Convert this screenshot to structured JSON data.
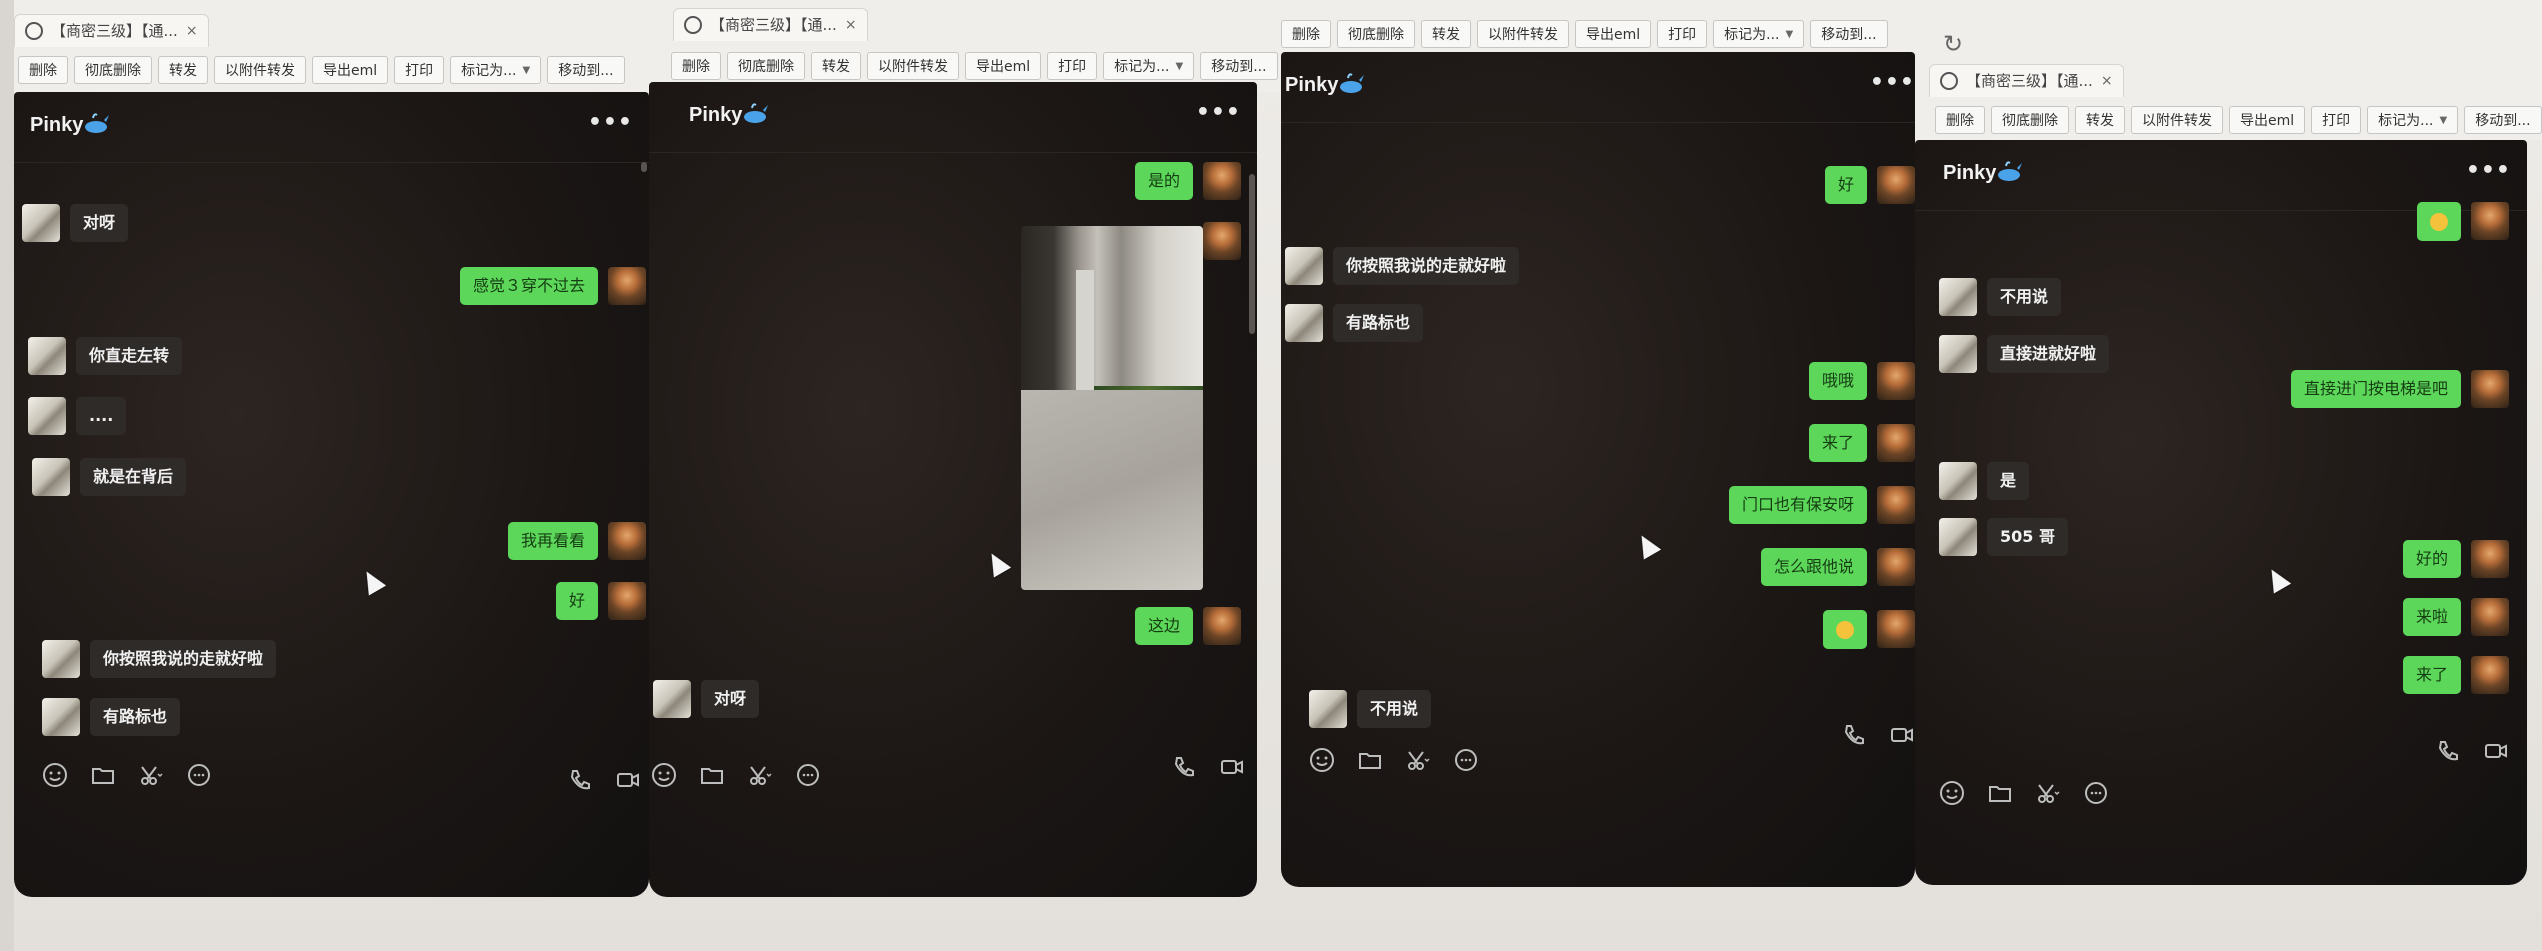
{
  "app": {
    "contact": "Pinky",
    "more": "•••"
  },
  "browser": {
    "tab_title": "【商密三级】【通...",
    "tab_close": "×",
    "toolbar": [
      "删除",
      "彻底删除",
      "转发",
      "以附件转发",
      "导出eml",
      "打印",
      "标记为...",
      "移动到..."
    ]
  },
  "panel1": {
    "messages": [
      {
        "from": "peer",
        "text": "对呀"
      },
      {
        "from": "me",
        "text": "感觉３穿不过去"
      },
      {
        "from": "peer",
        "text": "你直走左转"
      },
      {
        "from": "peer",
        "text": "...."
      },
      {
        "from": "peer",
        "text": "就是在背后"
      },
      {
        "from": "me",
        "text": "我再看看"
      },
      {
        "from": "me",
        "text": "好"
      },
      {
        "from": "peer",
        "text": "你按照我说的走就好啦"
      },
      {
        "from": "peer",
        "text": "有路标也"
      }
    ]
  },
  "panel2": {
    "messages": [
      {
        "from": "me",
        "text": "是的"
      },
      {
        "from": "me",
        "text": "这边"
      },
      {
        "from": "peer",
        "text": "对呀"
      }
    ]
  },
  "panel3": {
    "messages": [
      {
        "from": "peer",
        "text": "你按照我说的走就好啦"
      },
      {
        "from": "peer",
        "text": "有路标也"
      },
      {
        "from": "me",
        "text": "好"
      },
      {
        "from": "me",
        "text": "哦哦"
      },
      {
        "from": "me",
        "text": "来了"
      },
      {
        "from": "me",
        "text": "门口也有保安呀"
      },
      {
        "from": "me",
        "text": "怎么跟他说"
      },
      {
        "from": "peer",
        "text": "不用说"
      }
    ]
  },
  "panel4": {
    "messages": [
      {
        "from": "peer",
        "text": "不用说"
      },
      {
        "from": "peer",
        "text": "直接进就好啦"
      },
      {
        "from": "me",
        "text": "直接进门按电梯是吧"
      },
      {
        "from": "peer",
        "text": "是"
      },
      {
        "from": "peer",
        "text": "505 哥"
      },
      {
        "from": "me",
        "text": "好的"
      },
      {
        "from": "me",
        "text": "来啦"
      },
      {
        "from": "me",
        "text": "来了"
      }
    ]
  },
  "icons": [
    "emoji-icon",
    "folder-icon",
    "scissors-icon",
    "chat-bubble-icon",
    "phone-icon",
    "video-icon",
    "globe-icon",
    "reload-icon",
    "whale-emoji-icon",
    "cursor-icon"
  ],
  "colors": {
    "my_bubble": "#5cd75a",
    "peer_bubble": "#2f2b29",
    "chat_bg": "#1c1715"
  }
}
